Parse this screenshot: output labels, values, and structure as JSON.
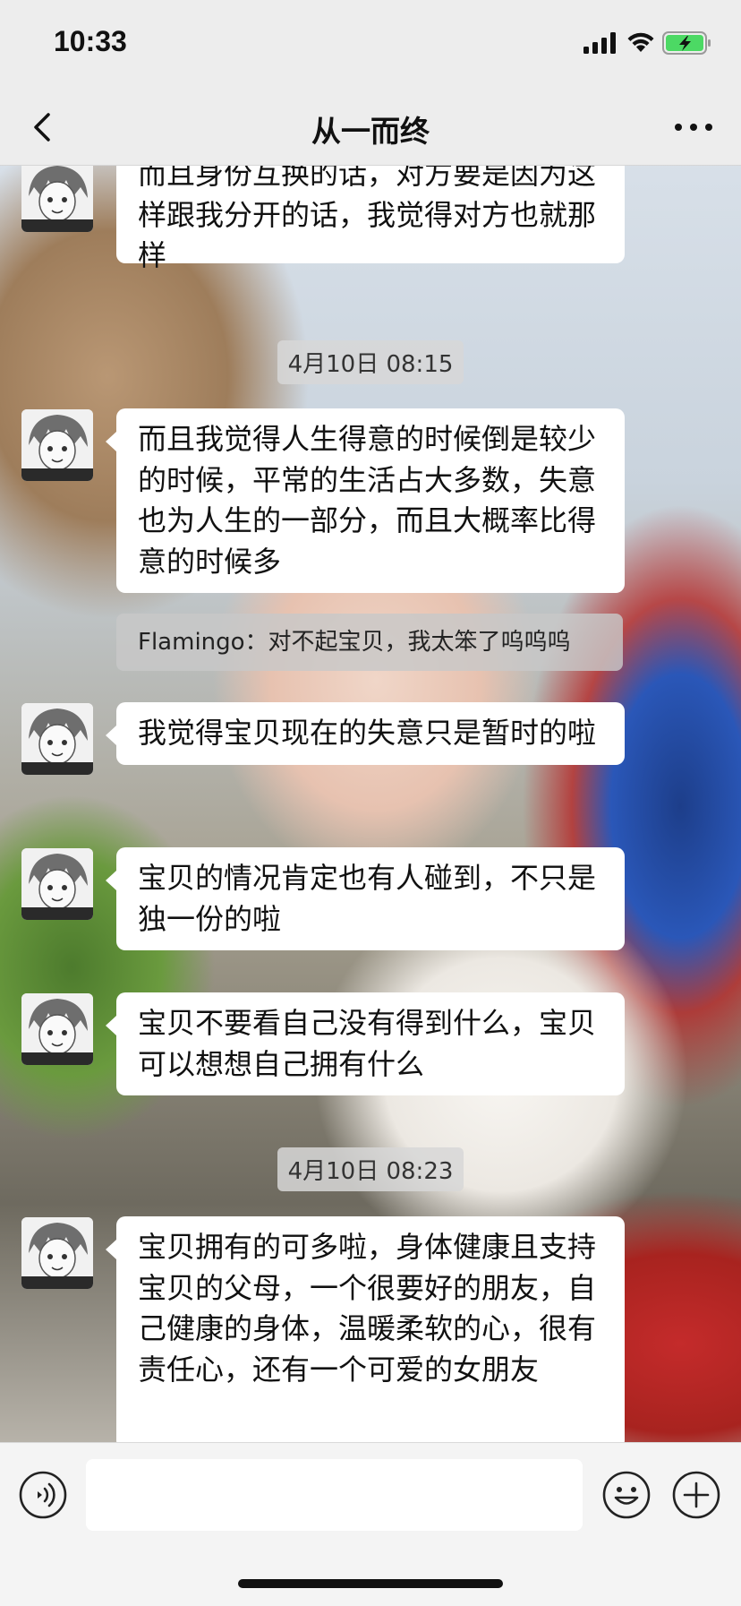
{
  "status_bar": {
    "time": "10:33"
  },
  "nav": {
    "title": "从一而终"
  },
  "messages": [
    {
      "type": "text",
      "text": "而且身份互换的话，对方要是因为这样跟我分开的话，我觉得对方也就那样"
    },
    {
      "type": "timestamp",
      "text": "4月10日 08:15"
    },
    {
      "type": "text",
      "text": "而且我觉得人生得意的时候倒是较少的时候，平常的生活占大多数，失意也为人生的一部分，而且大概率比得意的时候多"
    },
    {
      "type": "quote",
      "text": "Flamingo：对不起宝贝，我太笨了呜呜呜"
    },
    {
      "type": "text",
      "text": "我觉得宝贝现在的失意只是暂时的啦"
    },
    {
      "type": "text",
      "text": "宝贝的情况肯定也有人碰到，不只是独一份的啦"
    },
    {
      "type": "text",
      "text": "宝贝不要看自己没有得到什么，宝贝可以想想自己拥有什么"
    },
    {
      "type": "timestamp",
      "text": "4月10日 08:23"
    },
    {
      "type": "text",
      "text": "宝贝拥有的可多啦，身体健康且支持宝贝的父母，一个很要好的朋友，自己健康的身体，温暖柔软的心，很有责任心，还有一个可爱的女朋友"
    }
  ],
  "input": {
    "value": "",
    "placeholder": ""
  },
  "icons": {
    "back": "chevron-left-icon",
    "more": "more-dots-icon",
    "voice": "voice-icon",
    "emoji": "emoji-icon",
    "plus": "plus-icon",
    "signal": "signal-icon",
    "wifi": "wifi-icon",
    "battery": "battery-charging-icon"
  },
  "colors": {
    "battery_fill": "#4cd964",
    "bubble": "#ffffff",
    "bar_bg": "#ededed"
  }
}
